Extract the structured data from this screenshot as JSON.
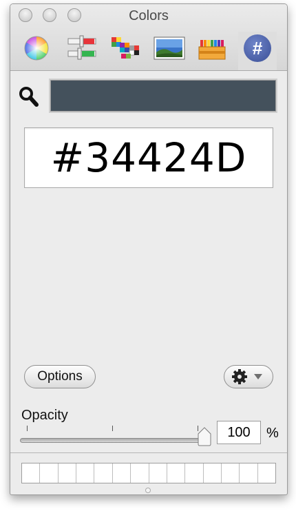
{
  "window": {
    "title": "Colors"
  },
  "toolbar": {
    "items": [
      {
        "name": "color-wheel",
        "icon": "color-wheel-icon"
      },
      {
        "name": "color-sliders",
        "icon": "sliders-icon"
      },
      {
        "name": "color-palettes",
        "icon": "palettes-icon"
      },
      {
        "name": "image-palettes",
        "icon": "image-palette-icon"
      },
      {
        "name": "crayons",
        "icon": "crayons-icon"
      },
      {
        "name": "hex-color-picker",
        "icon": "hash-icon",
        "label": "#",
        "active": true
      }
    ]
  },
  "search": {
    "icon": "magnifier-icon"
  },
  "current_color": {
    "hex_value": "#34424D",
    "swatch_color": "#44515c"
  },
  "buttons": {
    "options_label": "Options",
    "gear_icon": "gear-icon"
  },
  "opacity": {
    "label": "Opacity",
    "value": "100",
    "unit": "%",
    "level": 1.0
  },
  "favorites": {
    "slot_count": 14
  }
}
